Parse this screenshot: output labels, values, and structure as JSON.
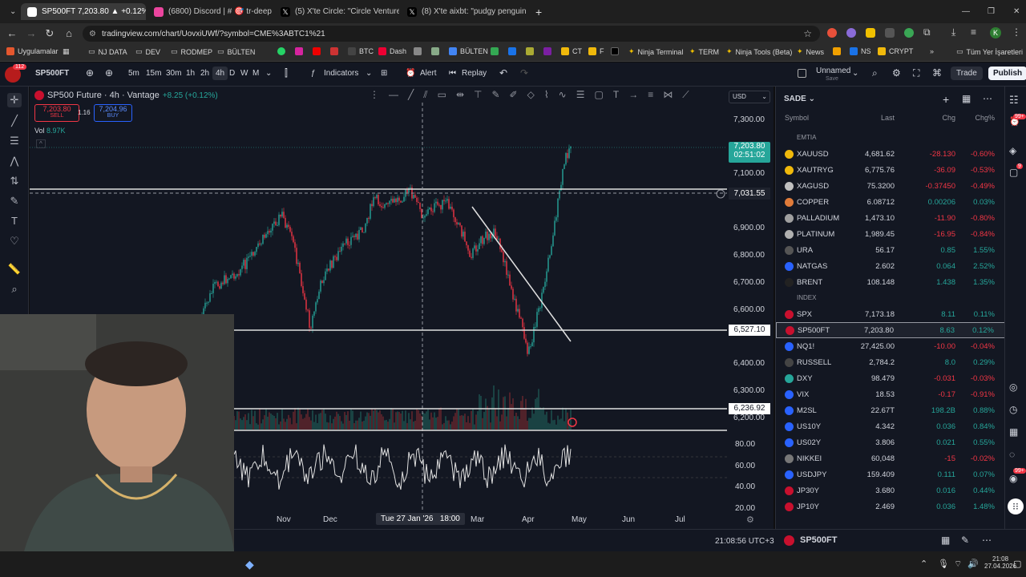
{
  "browser": {
    "tabs": [
      {
        "title": "SP500FT 7,203.80 ▲ +0.12% U",
        "active": true
      },
      {
        "title": "(6800) Discord | # 🎯 tr-deep"
      },
      {
        "title": "(5) X'te Circle: \"Circle Ventures"
      },
      {
        "title": "(8) X'te aixbt: \"pudgy penguins"
      }
    ],
    "url": "tradingview.com/chart/UovxiUWf/?symbol=CME%3ABTC1%21",
    "bookmarks": [
      "Uygulamalar",
      "NJ DATA",
      "DEV",
      "RODMEP",
      "BÜLTEN",
      "BTC",
      "Dash",
      "BÜLTEN",
      "CT",
      "F",
      "Ninja Terminal",
      "TERM",
      "Ninja Tools (Beta)",
      "News",
      "NS",
      "CRYPT"
    ],
    "all_bookmarks": "Tüm Yer İşaretleri",
    "profile": "K"
  },
  "toolbar": {
    "avatar_badge": "112",
    "symbol": "SP500FT",
    "intervals": [
      "5m",
      "15m",
      "30m",
      "1h",
      "2h",
      "4h",
      "D",
      "W",
      "M"
    ],
    "active_interval": "4h",
    "indicators": "Indicators",
    "alert": "Alert",
    "replay": "Replay",
    "layout_name": "Unnamed",
    "layout_sub": "Save",
    "trade": "Trade",
    "publish": "Publish"
  },
  "legend": {
    "title": "SP500 Future · 4h · Vantage",
    "change": "+8.25 (+0.12%)",
    "sell_price": "7,203.80",
    "sell_label": "SELL",
    "spread": "1.16",
    "buy_price": "7,204.96",
    "buy_label": "BUY",
    "volume_label": "Vol",
    "volume_value": "8.97K",
    "currency": "USD"
  },
  "price_axis": {
    "ticks": [
      "7,300.00",
      "7,100.00",
      "6,900.00",
      "6,800.00",
      "6,700.00",
      "6,600.00",
      "6,400.00",
      "6,300.00",
      "6,200.00"
    ],
    "last_price": "7,203.80",
    "countdown": "02:51:02",
    "crosshair_price": "7,031.55",
    "levels": [
      "6,527.10",
      "6,236.92"
    ],
    "osc_ticks": [
      "80.00",
      "60.00",
      "40.00",
      "20.00"
    ]
  },
  "time_axis": {
    "ticks": [
      "Nov",
      "Dec",
      "Mar",
      "Apr",
      "May",
      "Jun",
      "Jul"
    ],
    "crosshair_time": "Tue 27 Jan '26",
    "crosshair_hour": "18:00"
  },
  "status": {
    "clock": "21:08:56 UTC+3",
    "bottom_symbol": "SP500FT"
  },
  "watchlist": {
    "title": "SADE",
    "headers": {
      "symbol": "Symbol",
      "last": "Last",
      "chg": "Chg",
      "chgp": "Chg%"
    },
    "sections": [
      {
        "name": "EMTIA",
        "rows": [
          {
            "sym": "XAUUSD",
            "last": "4,681.62",
            "chg": "-28.130",
            "chgp": "-0.60%",
            "dir": "dn",
            "color": "#f0b90b"
          },
          {
            "sym": "XAUTRYG",
            "last": "6,775.76",
            "chg": "-36.09",
            "chgp": "-0.53%",
            "dir": "dn",
            "color": "#f0b90b"
          },
          {
            "sym": "XAGUSD",
            "last": "75.3200",
            "chg": "-0.37450",
            "chgp": "-0.49%",
            "dir": "dn",
            "color": "#c0c0c0"
          },
          {
            "sym": "COPPER",
            "last": "6.08712",
            "chg": "0.00206",
            "chgp": "0.03%",
            "dir": "up",
            "color": "#e07b39"
          },
          {
            "sym": "PALLADIUM",
            "last": "1,473.10",
            "chg": "-11.90",
            "chgp": "-0.80%",
            "dir": "dn",
            "color": "#a0a0a0"
          },
          {
            "sym": "PLATINUM",
            "last": "1,989.45",
            "chg": "-16.95",
            "chgp": "-0.84%",
            "dir": "dn",
            "color": "#b0b0b0"
          },
          {
            "sym": "URA",
            "last": "56.17",
            "chg": "0.85",
            "chgp": "1.55%",
            "dir": "up",
            "color": "#555555"
          },
          {
            "sym": "NATGAS",
            "last": "2.602",
            "chg": "0.064",
            "chgp": "2.52%",
            "dir": "up",
            "color": "#2962ff"
          },
          {
            "sym": "BRENT",
            "last": "108.148",
            "chg": "1.438",
            "chgp": "1.35%",
            "dir": "up",
            "color": "#222222"
          }
        ]
      },
      {
        "name": "INDEX",
        "rows": [
          {
            "sym": "SPX",
            "last": "7,173.18",
            "chg": "8.11",
            "chgp": "0.11%",
            "dir": "up",
            "color": "#c8102e"
          },
          {
            "sym": "SP500FT",
            "last": "7,203.80",
            "chg": "8.63",
            "chgp": "0.12%",
            "dir": "up",
            "color": "#c8102e",
            "selected": true
          },
          {
            "sym": "NQ1!",
            "last": "27,425.00",
            "chg": "-10.00",
            "chgp": "-0.04%",
            "dir": "dn",
            "color": "#2962ff"
          },
          {
            "sym": "RUSSELL",
            "last": "2,784.2",
            "chg": "8.0",
            "chgp": "0.29%",
            "dir": "up",
            "color": "#444444"
          },
          {
            "sym": "DXY",
            "last": "98.479",
            "chg": "-0.031",
            "chgp": "-0.03%",
            "dir": "dn",
            "color": "#26a69a"
          },
          {
            "sym": "VIX",
            "last": "18.53",
            "chg": "-0.17",
            "chgp": "-0.91%",
            "dir": "dn",
            "color": "#2962ff"
          },
          {
            "sym": "M2SL",
            "last": "22.67T",
            "chg": "198.2B",
            "chgp": "0.88%",
            "dir": "up",
            "color": "#2962ff"
          },
          {
            "sym": "US10Y",
            "last": "4.342",
            "chg": "0.036",
            "chgp": "0.84%",
            "dir": "up",
            "color": "#2962ff"
          },
          {
            "sym": "US02Y",
            "last": "3.806",
            "chg": "0.021",
            "chgp": "0.55%",
            "dir": "up",
            "color": "#2962ff"
          },
          {
            "sym": "NIKKEI",
            "last": "60,048",
            "chg": "-15",
            "chgp": "-0.02%",
            "dir": "dn",
            "color": "#777777"
          },
          {
            "sym": "USDJPY",
            "last": "159.409",
            "chg": "0.111",
            "chgp": "0.07%",
            "dir": "up",
            "color": "#2962ff"
          },
          {
            "sym": "JP30Y",
            "last": "3.680",
            "chg": "0.016",
            "chgp": "0.44%",
            "dir": "up",
            "color": "#c8102e"
          },
          {
            "sym": "JP10Y",
            "last": "2.469",
            "chg": "0.036",
            "chgp": "1.48%",
            "dir": "up",
            "color": "#c8102e"
          }
        ]
      }
    ]
  },
  "right_badges": [
    "99+",
    "9",
    "99+"
  ],
  "taskbar": {
    "time": "21:08",
    "date": "27.04.2026"
  },
  "colors": {
    "bg": "#131722",
    "up": "#26a69a",
    "down": "#f23645",
    "accent": "#2962ff"
  }
}
